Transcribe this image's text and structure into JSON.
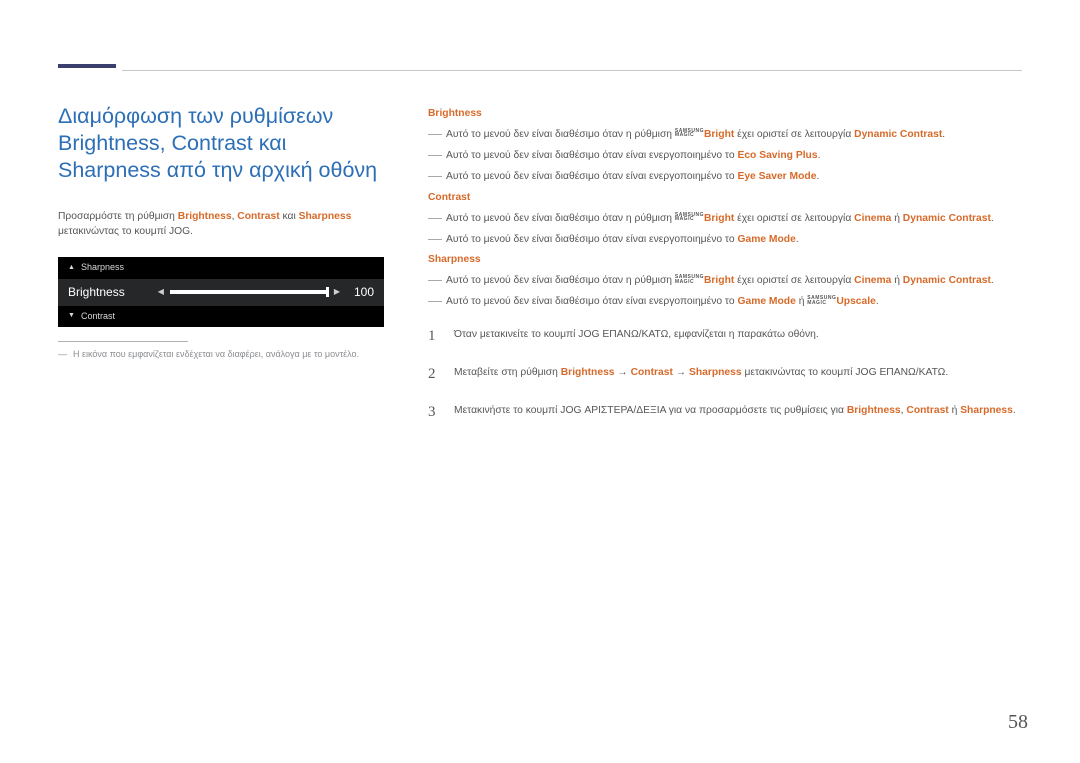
{
  "title": "Διαμόρφωση των ρυθμίσεων Brightness, Contrast και Sharpness από την αρχική οθόνη",
  "intro": {
    "p1": "Προσαρμόστε τη ρύθμιση ",
    "b": "Brightness",
    "sep1": ", ",
    "c": "Contrast",
    "sep2": " και ",
    "s": "Sharpness",
    "p2": " μετακινώντας το κουμπί JOG."
  },
  "osd": {
    "up_label": "Sharpness",
    "mid_label": "Brightness",
    "value": "100",
    "down_label": "Contrast"
  },
  "footnote": "Η εικόνα που εμφανίζεται ενδέχεται να διαφέρει, ανάλογα με το μοντέλο.",
  "magic": {
    "top": "SAMSUNG",
    "bot": "MAGIC"
  },
  "right": {
    "brightness": {
      "head": "Brightness",
      "d1a": "Αυτό το μενού δεν είναι διαθέσιμο όταν η ρύθμιση ",
      "d1b": "Bright",
      "d1c": " έχει οριστεί σε λειτουργία ",
      "d1d": "Dynamic Contrast",
      "d1e": ".",
      "d2a": "Αυτό το μενού δεν είναι διαθέσιμο όταν είναι ενεργοποιημένο το ",
      "d2b": "Eco Saving Plus",
      "d2c": ".",
      "d3a": "Αυτό το μενού δεν είναι διαθέσιμο όταν είναι ενεργοποιημένο το ",
      "d3b": "Eye Saver Mode",
      "d3c": "."
    },
    "contrast": {
      "head": "Contrast",
      "d1a": "Αυτό το μενού δεν είναι διαθέσιμο όταν η ρύθμιση ",
      "d1b": "Bright",
      "d1c": " έχει οριστεί σε λειτουργία ",
      "d1d": "Cinema",
      "d1e": " ή ",
      "d1f": "Dynamic Contrast",
      "d1g": ".",
      "d2a": "Αυτό το μενού δεν είναι διαθέσιμο όταν είναι ενεργοποιημένο το ",
      "d2b": "Game Mode",
      "d2c": "."
    },
    "sharpness": {
      "head": "Sharpness",
      "d1a": "Αυτό το μενού δεν είναι διαθέσιμο όταν η ρύθμιση ",
      "d1b": "Bright",
      "d1c": " έχει οριστεί σε λειτουργία ",
      "d1d": "Cinema",
      "d1e": " ή ",
      "d1f": "Dynamic Contrast",
      "d1g": ".",
      "d2a": "Αυτό το μενού δεν είναι διαθέσιμο όταν είναι ενεργοποιημένο το ",
      "d2b": "Game Mode",
      "d2c": " ή ",
      "d2d": "Upscale",
      "d2e": "."
    }
  },
  "steps": {
    "s1n": "1",
    "s1": "Όταν μετακινείτε το κουμπί JOG ΕΠΑΝΩ/ΚΑΤΩ, εμφανίζεται η παρακάτω οθόνη.",
    "s2n": "2",
    "s2a": "Μεταβείτε στη ρύθμιση ",
    "s2b": "Brightness",
    "s2arr1": " → ",
    "s2c": "Contrast",
    "s2arr2": " → ",
    "s2d": "Sharpness",
    "s2e": " μετακινώντας το κουμπί JOG ΕΠΑΝΩ/ΚΑΤΩ.",
    "s3n": "3",
    "s3a": "Μετακινήστε το κουμπί JOG ΑΡΙΣΤΕΡΑ/ΔΕΞΙΑ για να προσαρμόσετε τις ρυθμίσεις για ",
    "s3b": "Brightness",
    "s3sep1": ", ",
    "s3c": "Contrast",
    "s3sep2": " ή ",
    "s3d": "Sharpness",
    "s3e": "."
  },
  "page_num": "58"
}
